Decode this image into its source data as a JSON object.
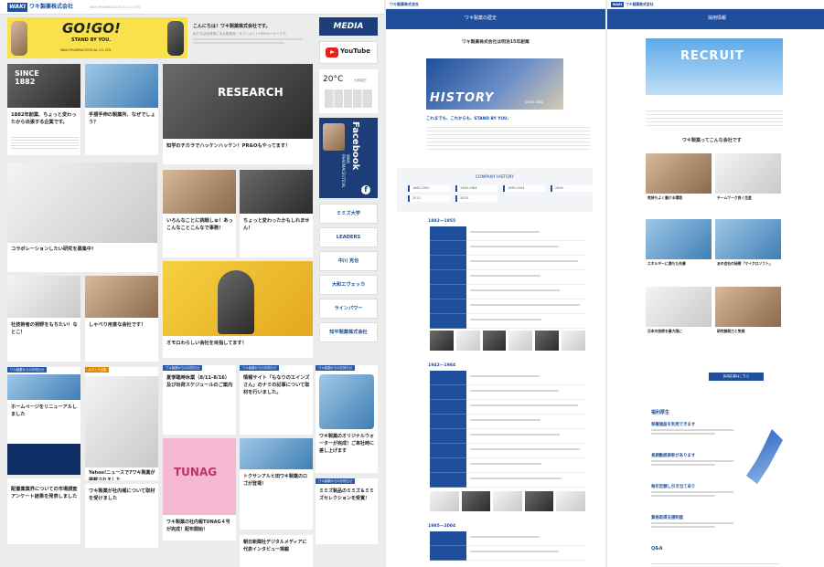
{
  "left_site": {
    "logo": "WAKI",
    "company": "ワキ製薬株式会社",
    "subtitle": "WAKI PHARMACEUTICAL CO.,LTD.",
    "nav": [
      "HOME",
      "INFORMATION",
      "COMPANY",
      "HISTORY",
      "PRODUCTS",
      "TEARIN",
      "SEMINAR",
      "RECRUIT",
      "CONTACT",
      "ENGLISH"
    ],
    "banner": {
      "main": "GO!GO!",
      "sub": "STAND BY YOU.",
      "brand": "WAKI PHARMACEUTICAL CO.,LTD."
    },
    "greeting": {
      "title": "こんにちは！ワキ製薬株式会社です。",
      "body": "私たちは奈良県にある医薬品・サプリメントOEMメーカーです。"
    },
    "side_buttons": {
      "media": "MEDIA",
      "youtube": "YouTube",
      "facebook": "Facebook",
      "facebook_caption": "WAKI PHARMACEUTICAL"
    },
    "weather": {
      "temp": "20°C",
      "location": "大和高田"
    },
    "sidebar_links": [
      "ミミズ大学",
      "LEADERS",
      "中川  克也",
      "大和エヴェッカ",
      "ラインパワー",
      "知平製薬株式会社"
    ],
    "posts": [
      {
        "label": "SINCE 1882",
        "title": "1882年創業、ちょっと変わったから出張する企業です。"
      },
      {
        "title": "手摺手伸の製薬所、なぜでしょう？"
      },
      {
        "title": "知学のチカラでハッケンハッケン！PR&Oもやってます！"
      },
      {
        "title": "いろんなことに挑戦しゅ！あっこんなことこんなで事務！"
      },
      {
        "title": "ちょっと変わったかもしれません！"
      },
      {
        "title": "コラボレーションしたい研究を募集中！"
      },
      {
        "title": "オモロわらしい会社を目指してます！"
      },
      {
        "title": "社技術者の視野をもちたい！なとこ！"
      },
      {
        "title": "しゃべり用意な会社です！"
      },
      {
        "badge": "ワキ製薬からのお知らせ",
        "title": "ホームページをリニューアルしました"
      },
      {
        "badge": "メディア出演",
        "title": "Yahoo!ニュースで7ワキ製薬が掲載されました"
      },
      {
        "badge": "ワキ製薬からのお知らせ",
        "title": "夏季臨時休業（8/11-8/16）及び出荷スケジュールのご案内"
      },
      {
        "badge": "ワキ製薬からのお知らせ",
        "title": "情報サイト「もなりのエインズさん」のナミの記事について取材を行いました。"
      },
      {
        "badge": "ワキ製薬からのお知らせ",
        "title": "ワキ製薬のオリジナルウォーターが完成！ご来社時に差し上げます"
      },
      {
        "title": "ワキ製薬の社内報TUNAG４号が完成！配布開始！"
      },
      {
        "title": "トクサンアルヒ田ワキ製薬のロゴが登場！"
      },
      {
        "badge": "ワキ製薬からのお知らせ",
        "title": "ミミズ製品のミミズ＆ミミズセレクションを受賞！"
      },
      {
        "title": "配置薬業界についての市場調査アンケート結果を発表しました"
      },
      {
        "title": "ワキ製薬が社内報について取材を受けました"
      },
      {
        "title": "朝日新聞社デジタルメディアに代表インタビュー掲載"
      }
    ]
  },
  "history_page": {
    "header_tab": "ワキ製薬の歴史",
    "section_title": "ワキ製薬株式会社は明治15年創業",
    "hero_word": "HISTORY",
    "hero_since": "SINCE 1882",
    "tagline": "これまでも、これからも、STAND BY YOU.",
    "company_history": "COMPANY HISTORY",
    "periods": [
      "1882-1955",
      "1956-1984",
      "1985-2004",
      "2005-",
      "2011-",
      "2020-"
    ],
    "era1": "1882—1955",
    "era2": "1942—1984",
    "era3": "1985—2004"
  },
  "recruit_page": {
    "header_tab": "採用情報",
    "banner": "RECRUIT",
    "section": "ワキ製薬ってこんな会社です",
    "cards": [
      "気持ちよく働ける環境",
      "チームワーク良く生産",
      "エネルギーに満ちた先輩",
      "あの会社の秘密「マイクロソフト」",
      "日本の技術を最大限に",
      "研究開発力と気候"
    ],
    "welfare": "福利厚生",
    "benefits": [
      "保養施設を利用できます",
      "長期勤続表彰があります",
      "毎年定額し引き当てあり",
      "資格取得支援制度"
    ],
    "qa": "Q&A",
    "entry_button": "採用応募はこちら",
    "logo": "WAKI",
    "company": "ワキ製薬株式会社"
  }
}
